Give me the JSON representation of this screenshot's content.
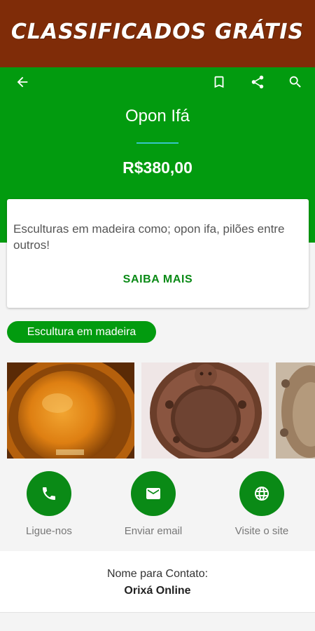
{
  "banner": {
    "title": "CLASSIFICADOS GRÁTIS"
  },
  "toolbar": {
    "icons": [
      "back-arrow-icon",
      "bookmark-icon",
      "share-icon",
      "search-icon"
    ]
  },
  "product": {
    "title": "Opon Ifá",
    "price": "R$380,00"
  },
  "description": {
    "text": "Esculturas em madeira como; opon ifa, pilões entre outros!",
    "more_label": "SAIBA MAIS"
  },
  "category": {
    "label": "Escultura em madeira"
  },
  "actions": [
    {
      "icon": "phone-icon",
      "label": "Ligue-nos"
    },
    {
      "icon": "email-icon",
      "label": "Enviar email"
    },
    {
      "icon": "globe-icon",
      "label": "Visite o site"
    }
  ],
  "contact": {
    "label": "Nome para Contato:",
    "name": "Orixá Online"
  },
  "colors": {
    "banner": "#7f2c08",
    "primary": "#029b0f",
    "accent": "#0a8a16",
    "rule": "#36c6c6"
  }
}
